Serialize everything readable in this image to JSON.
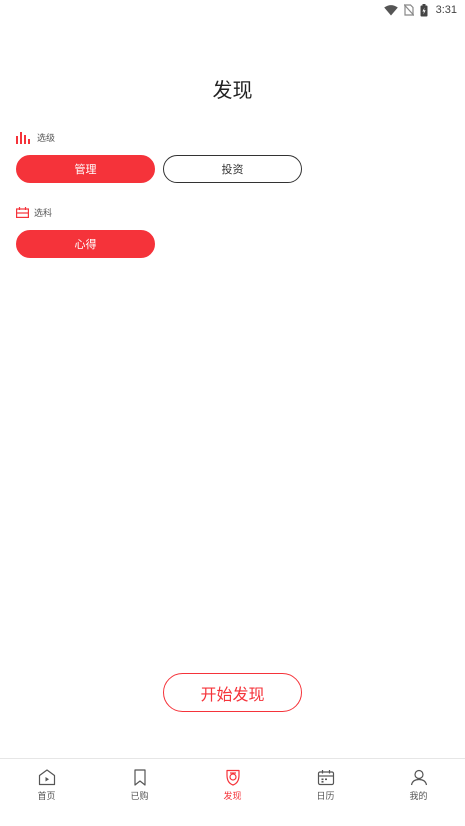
{
  "status_bar": {
    "time": "3:31",
    "icons": [
      "wifi-icon",
      "no-sim-icon",
      "battery-charging-icon"
    ]
  },
  "page": {
    "title": "发现"
  },
  "sections": [
    {
      "label": "选级",
      "icon": "bar-level-icon",
      "options": [
        {
          "label": "管理",
          "selected": true
        },
        {
          "label": "投资",
          "selected": false
        }
      ]
    },
    {
      "label": "选科",
      "icon": "subject-icon",
      "options": [
        {
          "label": "心得",
          "selected": true
        }
      ]
    }
  ],
  "cta": {
    "label": "开始发现"
  },
  "tabs": [
    {
      "label": "首页",
      "icon": "home-play-icon",
      "active": false
    },
    {
      "label": "已购",
      "icon": "bookmark-icon",
      "active": false
    },
    {
      "label": "发现",
      "icon": "discover-icon",
      "active": true
    },
    {
      "label": "日历",
      "icon": "calendar-icon",
      "active": false
    },
    {
      "label": "我的",
      "icon": "user-icon",
      "active": false
    }
  ],
  "colors": {
    "accent": "#f5333a",
    "text": "#333333",
    "divider": "#e6e6e6"
  }
}
